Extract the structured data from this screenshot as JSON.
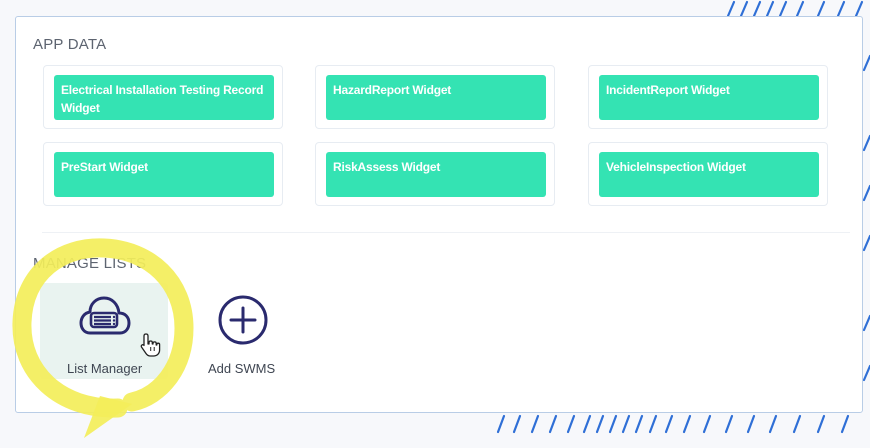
{
  "app_data": {
    "title": "APP DATA",
    "widgets": [
      {
        "label": "Electrical Installation Testing Record Widget"
      },
      {
        "label": "HazardReport Widget"
      },
      {
        "label": "IncidentReport Widget"
      },
      {
        "label": "PreStart Widget"
      },
      {
        "label": "RiskAssess Widget"
      },
      {
        "label": "VehicleInspection Widget"
      }
    ]
  },
  "manage_lists": {
    "title": "MANAGE LISTS",
    "tools": [
      {
        "label": "List Manager",
        "icon": "cloud-list-icon"
      },
      {
        "label": "Add SWMS",
        "icon": "plus-circle-icon"
      }
    ]
  },
  "colors": {
    "widget_green": "#34e3b3",
    "icon_navy": "#2a2a6e",
    "highlight_yellow": "#f3ee5a",
    "card_border": "#b9cde6",
    "stripe_blue": "#2f6fd6"
  }
}
